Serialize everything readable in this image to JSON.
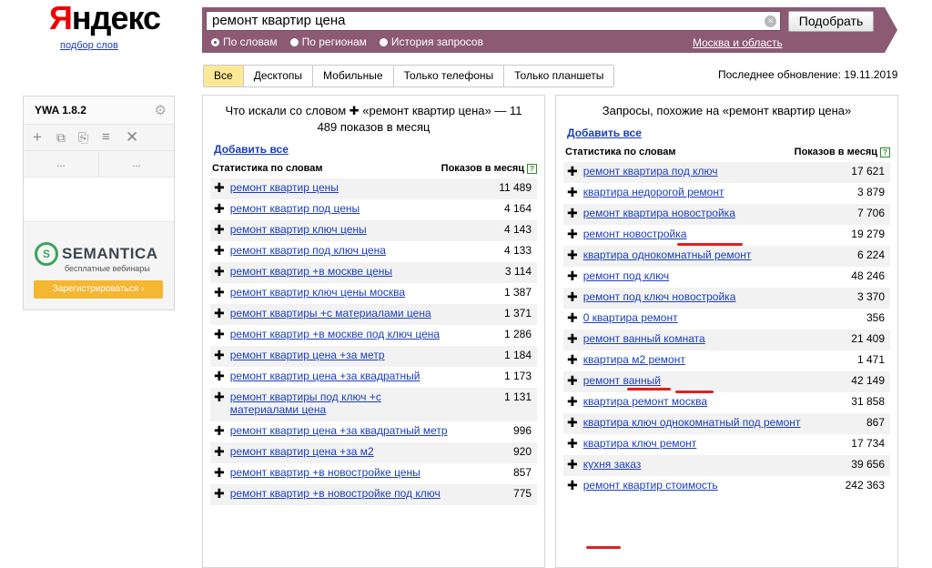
{
  "header": {
    "logo_y": "Я",
    "logo_rest": "ндекс",
    "logo_sub": "подбор слов",
    "search_value": "ремонт квартир цена",
    "clear_icon": "×",
    "submit_label": "Подобрать",
    "radios": [
      {
        "label": "По словам",
        "checked": true
      },
      {
        "label": "По регионам",
        "checked": false
      },
      {
        "label": "История запросов",
        "checked": false
      }
    ],
    "region": "Москва и область"
  },
  "tabs": [
    "Все",
    "Десктопы",
    "Мобильные",
    "Только телефоны",
    "Только планшеты"
  ],
  "active_tab": "Все",
  "updated": "Последнее обновление: 19.11.2019",
  "sidebar": {
    "title": "YWA 1.8.2",
    "col1": "...",
    "col2": "...",
    "semantica_name": "SEMANTICA",
    "semantica_sub": "бесплатные вебинары",
    "semantica_button": "Зарегистрироваться ›"
  },
  "left_panel": {
    "title": "Что искали со словом ✚ «ремонт квартир цена» — 11 489 показов в месяц",
    "add_all": "Добавить все",
    "col_left": "Статистика по словам",
    "col_right": "Показов в месяц",
    "rows": [
      {
        "q": "ремонт квартир цены",
        "n": "11 489"
      },
      {
        "q": "ремонт квартир под цены",
        "n": "4 164"
      },
      {
        "q": "ремонт квартир ключ цены",
        "n": "4 143"
      },
      {
        "q": "ремонт квартир под ключ цена",
        "n": "4 133"
      },
      {
        "q": "ремонт квартир +в москве цены",
        "n": "3 114"
      },
      {
        "q": "ремонт квартир ключ цены москва",
        "n": "1 387"
      },
      {
        "q": "ремонт квартиры +с материалами цена",
        "n": "1 371"
      },
      {
        "q": "ремонт квартир +в москве под ключ цена",
        "n": "1 286"
      },
      {
        "q": "ремонт квартир цена +за метр",
        "n": "1 184"
      },
      {
        "q": "ремонт квартир цена +за квадратный",
        "n": "1 173"
      },
      {
        "q": "ремонт квартиры под ключ +с материалами цена",
        "n": "1 131"
      },
      {
        "q": "ремонт квартир цена +за квадратный метр",
        "n": "996"
      },
      {
        "q": "ремонт квартир цена +за м2",
        "n": "920"
      },
      {
        "q": "ремонт квартир +в новостройке цены",
        "n": "857"
      },
      {
        "q": "ремонт квартир +в новостройке под ключ",
        "n": "775"
      }
    ]
  },
  "right_panel": {
    "title": "Запросы, похожие на «ремонт квартир цена»",
    "add_all": "Добавить все",
    "col_left": "Статистика по словам",
    "col_right": "Показов в месяц",
    "rows": [
      {
        "q": "ремонт квартира под ключ",
        "n": "17 621"
      },
      {
        "q": "квартира недорогой ремонт",
        "n": "3 879"
      },
      {
        "q": "ремонт квартира новостройка",
        "n": "7 706"
      },
      {
        "q": "ремонт новостройка",
        "n": "19 279"
      },
      {
        "q": "квартира однокомнатный ремонт",
        "n": "6 224"
      },
      {
        "q": "ремонт под ключ",
        "n": "48 246"
      },
      {
        "q": "ремонт под ключ новостройка",
        "n": "3 370"
      },
      {
        "q": "0 квартира ремонт",
        "n": "356"
      },
      {
        "q": "ремонт ванный комната",
        "n": "21 409"
      },
      {
        "q": "квартира м2 ремонт",
        "n": "1 471"
      },
      {
        "q": "ремонт ванный",
        "n": "42 149"
      },
      {
        "q": "квартира ремонт москва",
        "n": "31 858"
      },
      {
        "q": "квартира ключ однокомнатный под ремонт",
        "n": "867"
      },
      {
        "q": "квартира ключ ремонт",
        "n": "17 734"
      },
      {
        "q": "кухня заказ",
        "n": "39 656"
      },
      {
        "q": "ремонт квартир стоимость",
        "n": "242 363"
      }
    ]
  },
  "colors": {
    "brand_bar": "#8c5a73",
    "link": "#1a3dc1",
    "active_tab": "#fde896",
    "mark": "#e02020"
  }
}
